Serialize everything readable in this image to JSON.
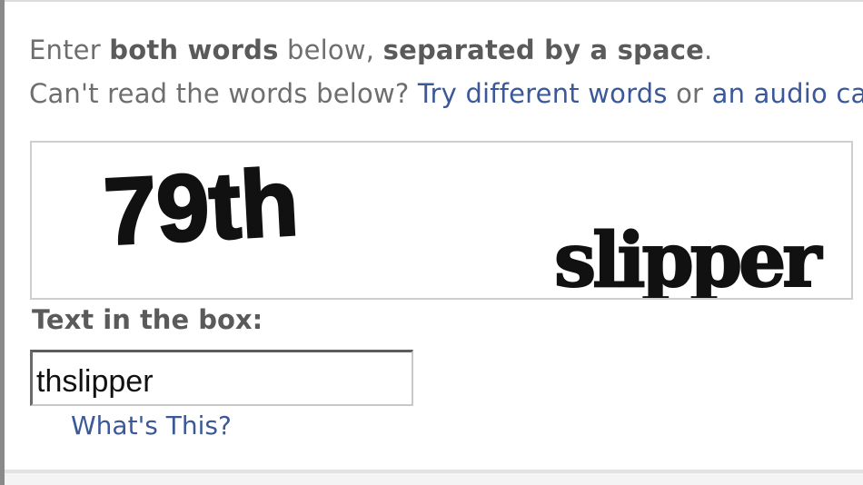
{
  "instructions": {
    "enter": "Enter",
    "both_words": "both words",
    "below": "below,",
    "separated": "separated by a space",
    "period": ".",
    "cant_read": "Can't read the words below?",
    "try_different": "Try different words",
    "or": "or",
    "audio": "an audio captcha"
  },
  "captcha": {
    "word1": "79th",
    "word2": "slipper"
  },
  "input": {
    "label": "Text in the box:",
    "value": "thslipper"
  },
  "help_link": "What's This?",
  "colors": {
    "link": "#3b5998",
    "text": "#6e6e6e",
    "bold_text": "#5a5a5a"
  }
}
